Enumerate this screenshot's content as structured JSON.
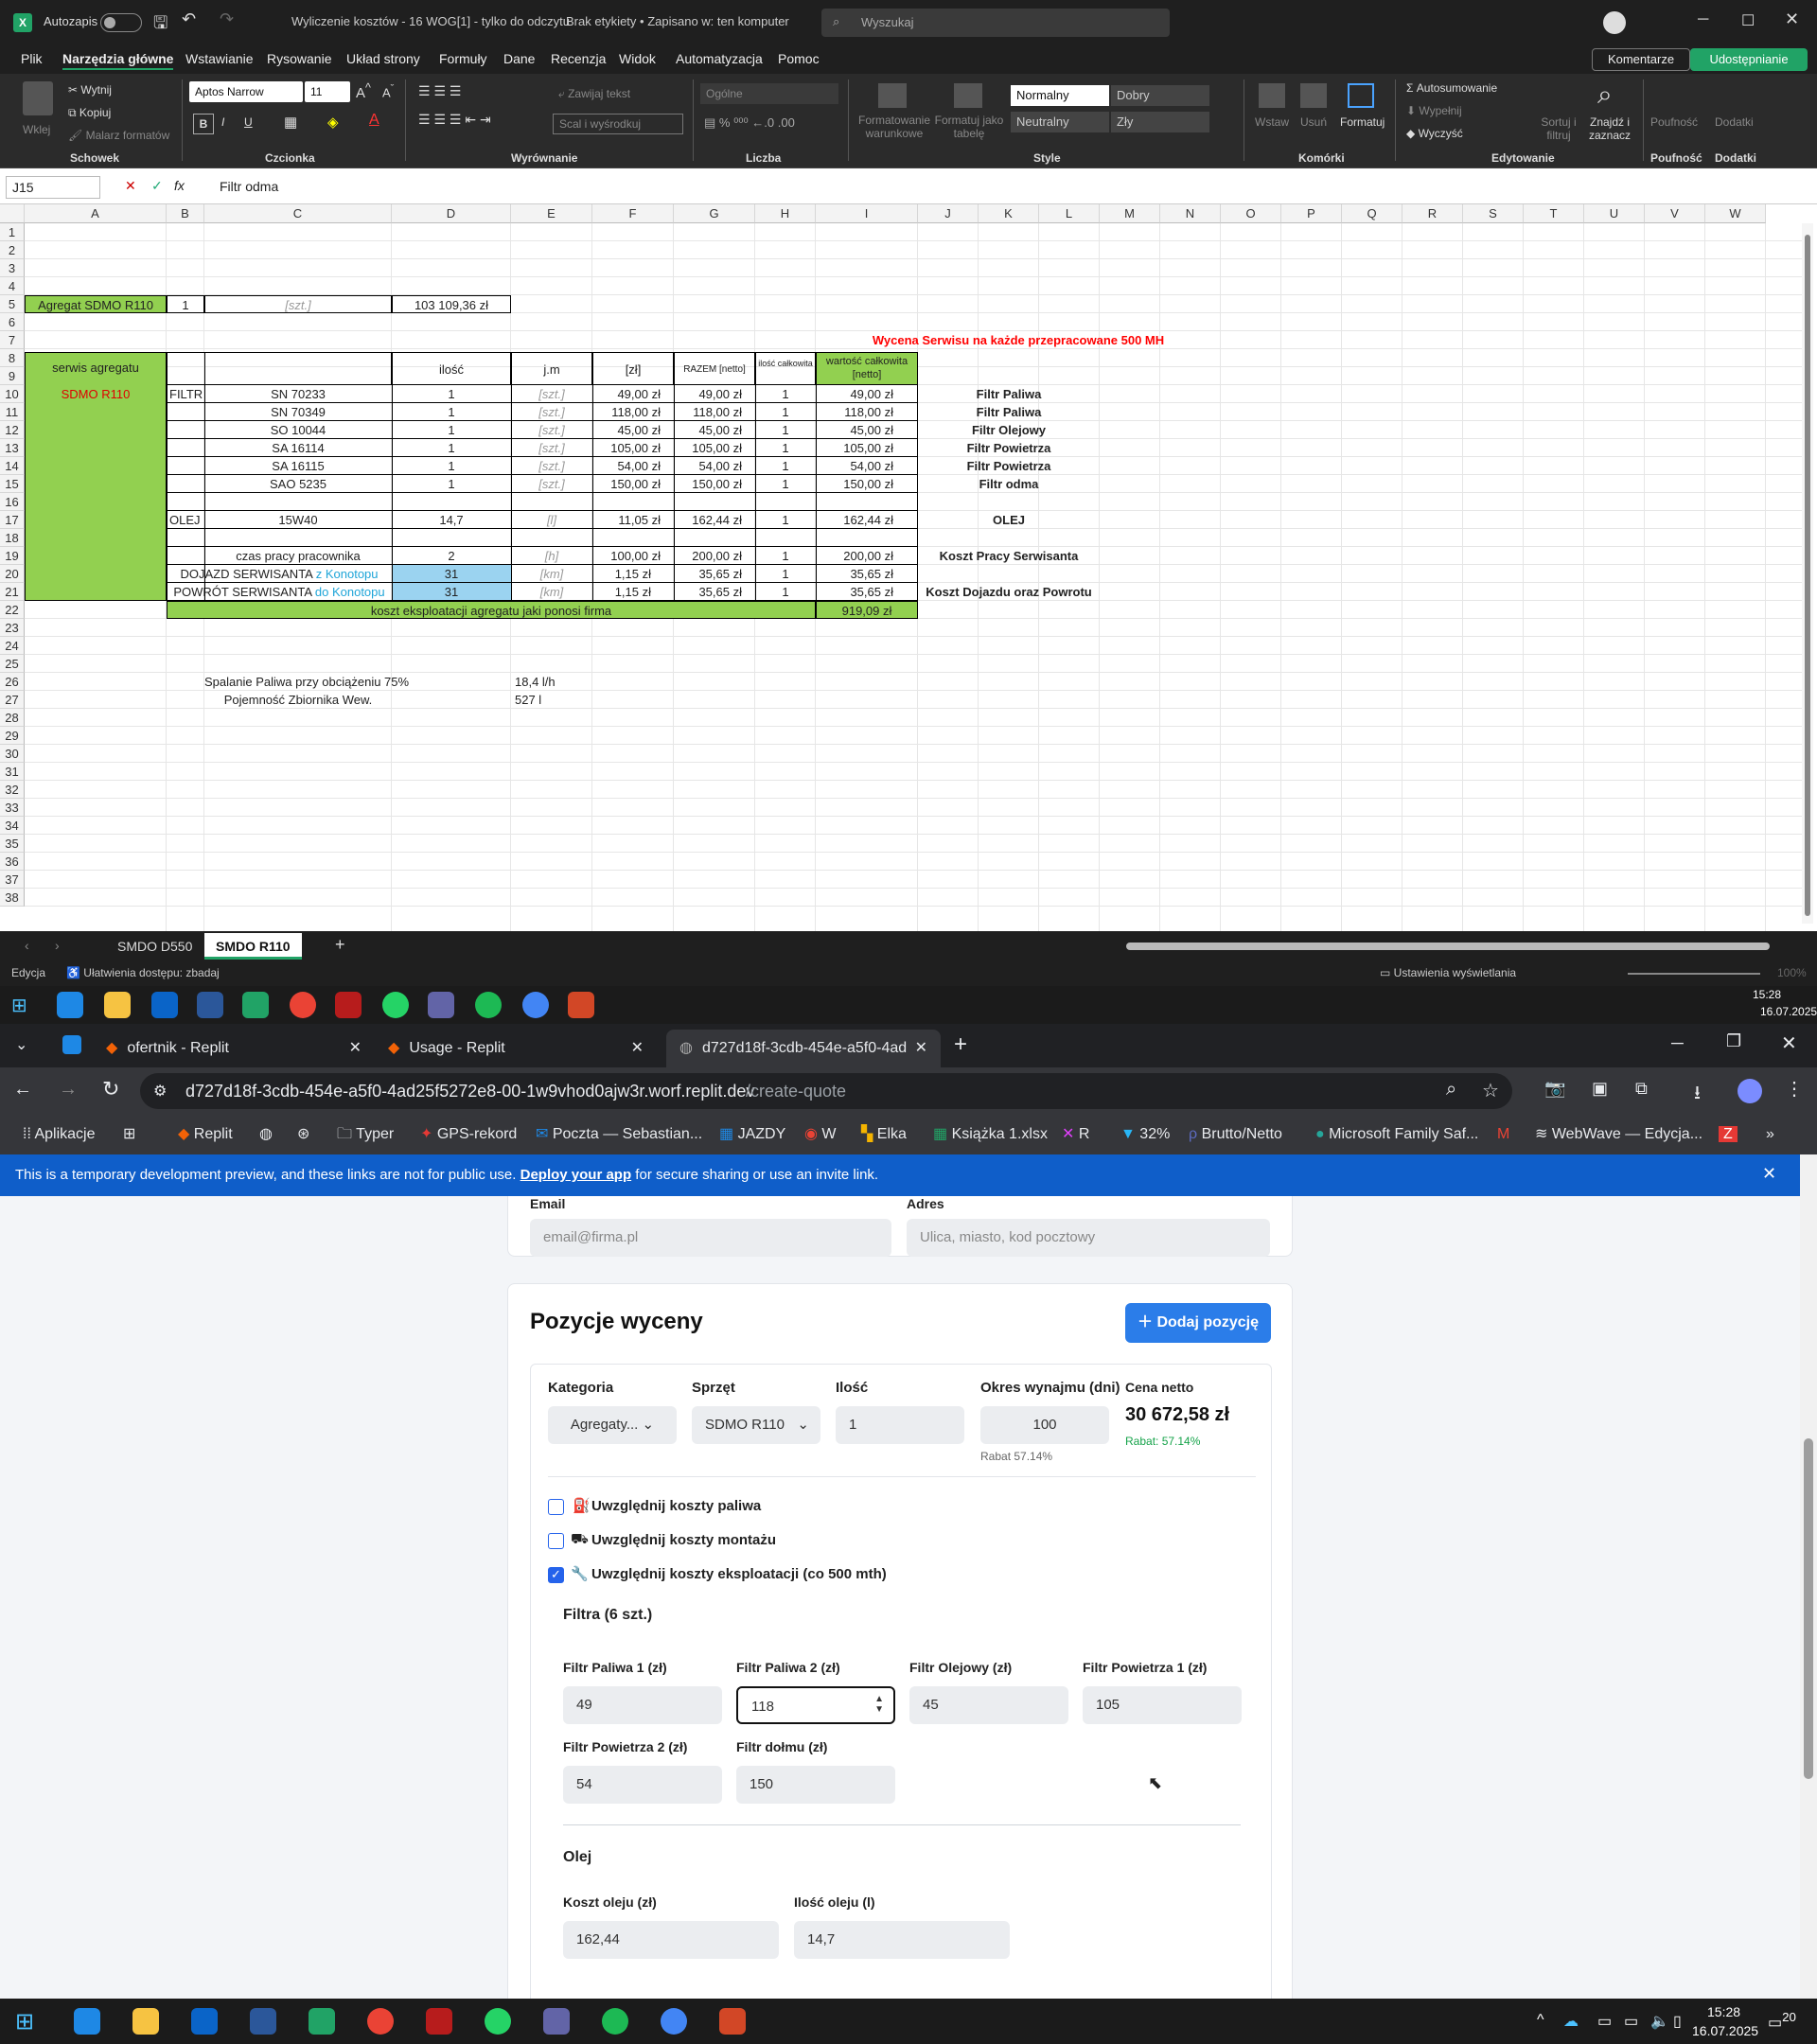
{
  "excel": {
    "autosave_label": "Autozapis",
    "doc_title": "Wyliczenie kosztów - 16 WOG[1]  -  tylko do odczytu",
    "label_status": "Brak etykiety • Zapisano w: ten komputer",
    "search_placeholder": "Wyszukaj",
    "tabs": [
      "Plik",
      "Narzędzia główne",
      "Wstawianie",
      "Rysowanie",
      "Układ strony",
      "Formuły",
      "Dane",
      "Recenzja",
      "Widok",
      "Automatyzacja",
      "Pomoc"
    ],
    "comments_label": "Komentarze",
    "share_label": "Udostępnianie",
    "ribbon": {
      "paste": "Wklej",
      "cut": "Wytnij",
      "copy": "Kopiuj",
      "format_painter": "Malarz formatów",
      "clipboard": "Schowek",
      "font_name": "Aptos Narrow",
      "font_size": "11",
      "font_group": "Czcionka",
      "wrap": "Zawijaj tekst",
      "merge": "Scal i wyśrodkuj",
      "align_group": "Wyrównanie",
      "number_format": "Ogólne",
      "number_group": "Liczba",
      "cond_format": "Formatowanie warunkowe",
      "format_table": "Formatuj jako tabelę",
      "style_normal": "Normalny",
      "style_good": "Dobry",
      "style_neutral": "Neutralny",
      "style_bad": "Zły",
      "style_group": "Style",
      "insert": "Wstaw",
      "delete": "Usuń",
      "format": "Formatuj",
      "cells_group": "Komórki",
      "autosum": "Autosumowanie",
      "fill": "Wypełnij",
      "clear": "Wyczyść",
      "sort": "Sortuj i filtruj",
      "find": "Znajdź i zaznacz",
      "edit_group": "Edytowanie",
      "sensitivity": "Poufność",
      "addins": "Dodatki"
    },
    "name_box": "J15",
    "fx": "fx",
    "formula": "Filtr odma",
    "columns": [
      "A",
      "B",
      "C",
      "D",
      "E",
      "F",
      "G",
      "H",
      "I",
      "J",
      "K",
      "L",
      "M",
      "N",
      "O",
      "P",
      "Q",
      "R",
      "S",
      "T",
      "U",
      "V",
      "W"
    ],
    "rows": [
      "1",
      "2",
      "3",
      "4",
      "5",
      "6",
      "7",
      "8",
      "9",
      "10",
      "11",
      "12",
      "13",
      "14",
      "15",
      "16",
      "17",
      "18",
      "19",
      "20",
      "21",
      "22",
      "23",
      "24",
      "25",
      "26",
      "27",
      "28",
      "29",
      "30",
      "31",
      "32",
      "33",
      "34",
      "35",
      "36",
      "37",
      "38"
    ],
    "cells": {
      "a5": "Agregat SDMO R110",
      "b5": "1",
      "c5": "[szt.]",
      "d5": "103 109,36 zł",
      "title7": "Wycena Serwisu na każde przepracowane 500 MH",
      "a9": "serwis agregatu",
      "a10": "SDMO R110",
      "d9": "ilość",
      "e9": "j.m",
      "f9": "[zł]",
      "g9": "RAZEM [netto]",
      "h9": "ilość całkowita",
      "i9": "wartość całkowita [netto]",
      "b10": "FILTR",
      "b17": "OLEJ",
      "r10": [
        "SN 70233",
        "1",
        "[szt.]",
        "49,00 zł",
        "49,00 zł",
        "1",
        "49,00 zł",
        "Filtr Paliwa"
      ],
      "r11": [
        "SN 70349",
        "1",
        "[szt.]",
        "118,00 zł",
        "118,00 zł",
        "1",
        "118,00 zł",
        "Filtr Paliwa"
      ],
      "r12": [
        "SO 10044",
        "1",
        "[szt.]",
        "45,00 zł",
        "45,00 zł",
        "1",
        "45,00 zł",
        "Filtr Olejowy"
      ],
      "r13": [
        "SA 16114",
        "1",
        "[szt.]",
        "105,00 zł",
        "105,00 zł",
        "1",
        "105,00 zł",
        "Filtr Powietrza"
      ],
      "r14": [
        "SA 16115",
        "1",
        "[szt.]",
        "54,00 zł",
        "54,00 zł",
        "1",
        "54,00 zł",
        "Filtr Powietrza"
      ],
      "r15": [
        "SAO 5235",
        "1",
        "[szt.]",
        "150,00 zł",
        "150,00 zł",
        "1",
        "150,00 zł",
        "Filtr odma"
      ],
      "r17": [
        "15W40",
        "14,7",
        "[l]",
        "11,05 zł",
        "162,44 zł",
        "1",
        "162,44 zł",
        "OLEJ"
      ],
      "r19": [
        "czas pracy pracownika",
        "2",
        "[h]",
        "100,00 zł",
        "200,00 zł",
        "1",
        "200,00 zł",
        "Koszt Pracy Serwisanta"
      ],
      "r20a": "DOJAZD SERWISANTA ",
      "r20b": "z Konotopu",
      "r20": [
        "31",
        "[km]",
        "1,15 zł",
        "35,65 zł",
        "1",
        "35,65 zł"
      ],
      "r21a": "POWRÓT SERWISANTA ",
      "r21b": "do Konotopu",
      "r21": [
        "31",
        "[km]",
        "1,15 zł",
        "35,65 zł",
        "1",
        "35,65 zł",
        "Koszt Dojazdu oraz Powrotu"
      ],
      "r22": "koszt eksploatacji agregatu jaki ponosi firma",
      "r22v": "919,09 zł",
      "r26a": "Spalanie Paliwa przy obciążeniu 75%",
      "r26b": "18,4 l/h",
      "r27a": "Pojemność Zbiornika Wew.",
      "r27b": "527 l"
    },
    "sheets": [
      "SMDO D550",
      "SMDO R110"
    ],
    "status_mode": "Edycja",
    "accessibility": "Ułatwienia dostępu: zbadaj",
    "display_settings": "Ustawienia wyświetlania",
    "zoom": "100%"
  },
  "taskbar_top": {
    "time": "15:28",
    "date": "16.07.2025"
  },
  "browser": {
    "tabs": [
      "ofertnik - Replit",
      "Usage - Replit",
      "d727d18f-3cdb-454e-a5f0-4ad"
    ],
    "url_host": "d727d18f-3cdb-454e-a5f0-4ad25f5272e8-00-1w9vhod0ajw3r.worf.replit.dev",
    "url_path": "/create-quote",
    "bookmarks": [
      "Aplikacje",
      "Replit",
      "Typer",
      "GPS-rekord",
      "Poczta — Sebastian...",
      "JAZDY",
      "W",
      "Elka",
      "Książka 1.xlsx",
      "R",
      "32%",
      "Brutto/Netto",
      "Microsoft Family Saf...",
      "WebWave — Edycja..."
    ],
    "banner_text": "This is a temporary development preview, and these links are not for public use. ",
    "banner_link": "Deploy your app",
    "banner_tail": " for secure sharing or use an invite link."
  },
  "app": {
    "email_label": "Email",
    "email_placeholder": "email@firma.pl",
    "address_label": "Adres",
    "address_placeholder": "Ulica, miasto, kod pocztowy",
    "section_title": "Pozycje wyceny",
    "add_button": "Dodaj pozycję",
    "col_category": "Kategoria",
    "col_equipment": "Sprzęt",
    "col_qty": "Ilość",
    "col_period": "Okres wynajmu (dni)",
    "col_price": "Cena netto",
    "category_value": "Agregaty...",
    "equipment_value": "SDMO R110",
    "qty_value": "1",
    "period_value": "100",
    "period_discount": "Rabat 57.14%",
    "price_value": "30 672,58 zł",
    "price_discount": "Rabat: 57.14%",
    "fuel_costs": "Uwzględnij koszty paliwa",
    "mount_costs": "Uwzględnij koszty montażu",
    "oper_costs": "Uwzględnij koszty eksploatacji (co 500 mth)",
    "filters_title": "Filtra (6 szt.)",
    "fields": [
      {
        "label": "Filtr Paliwa 1 (zł)",
        "value": "49"
      },
      {
        "label": "Filtr Paliwa 2 (zł)",
        "value": "118"
      },
      {
        "label": "Filtr Olejowy (zł)",
        "value": "45"
      },
      {
        "label": "Filtr Powietrza 1 (zł)",
        "value": "105"
      },
      {
        "label": "Filtr Powietrza 2 (zł)",
        "value": "54"
      },
      {
        "label": "Filtr dołmu (zł)",
        "value": "150"
      }
    ],
    "oil_title": "Olej",
    "oil_cost_label": "Koszt oleju (zł)",
    "oil_cost_value": "162,44",
    "oil_qty_label": "Ilość oleju (l)",
    "oil_qty_value": "14,7"
  },
  "taskbar_bottom": {
    "time": "15:28",
    "date": "16.07.2025",
    "notif": "20"
  },
  "colors": {
    "green": "#92d050",
    "light_blue": "#9bd3f0",
    "red_title": "#ff0000",
    "accent_blue": "#2b7de9",
    "excel_green": "#21a366"
  }
}
